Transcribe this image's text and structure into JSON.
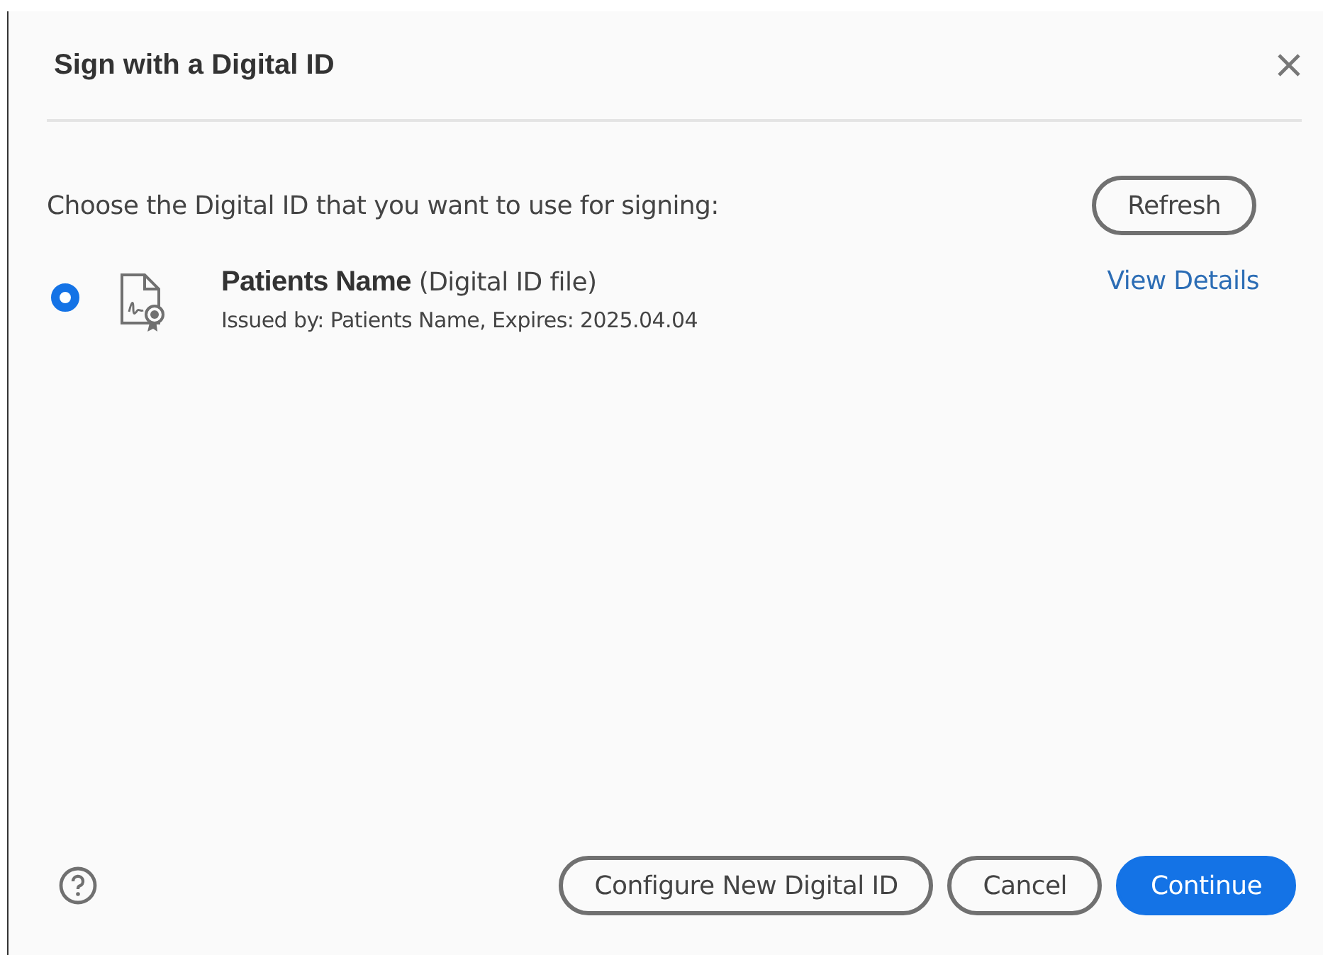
{
  "dialog": {
    "title": "Sign with a Digital ID"
  },
  "prompt": "Choose the Digital ID that you want to use for signing:",
  "refresh_button": "Refresh",
  "digital_ids": [
    {
      "name": "Patients Name",
      "type": "(Digital ID file)",
      "details": "Issued by: Patients Name, Expires: 2025.04.04",
      "selected": true,
      "link": "View Details"
    }
  ],
  "footer_buttons": [
    {
      "label": "Configure New Digital ID",
      "kind": "secondary"
    },
    {
      "label": "Cancel",
      "kind": "secondary"
    },
    {
      "label": "Continue",
      "kind": "primary"
    }
  ]
}
